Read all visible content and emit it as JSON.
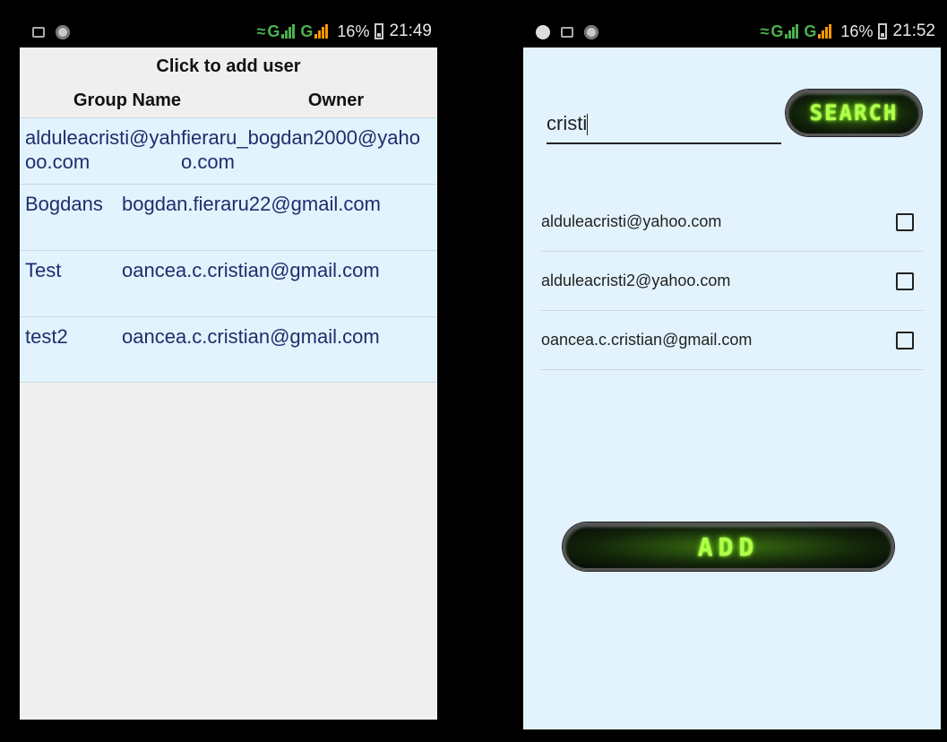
{
  "left": {
    "status": {
      "pct": "16%",
      "time": "21:49"
    },
    "add_user_label": "Click to add user",
    "columns": [
      "Group Name",
      "Owner"
    ],
    "rows": [
      {
        "group": "alduleacristi@yahoo.com",
        "owner": "fieraru_bogdan2000@yahoo.com"
      },
      {
        "group": "Bogdans",
        "owner": "bogdan.fieraru22@gmail.com"
      },
      {
        "group": "Test",
        "owner": "oancea.c.cristian@gmail.com"
      },
      {
        "group": "test2",
        "owner": "oancea.c.cristian@gmail.com"
      }
    ]
  },
  "right": {
    "status": {
      "pct": "16%",
      "time": "21:52"
    },
    "search_value": "cristi",
    "search_label": "SEARCH",
    "results": [
      {
        "email": "alduleacristi@yahoo.com",
        "checked": false
      },
      {
        "email": "alduleacristi2@yahoo.com",
        "checked": false
      },
      {
        "email": "oancea.c.cristian@gmail.com",
        "checked": false
      }
    ],
    "add_label": "ADD"
  },
  "icons": [
    "image-icon",
    "shield-icon",
    "messenger-icon",
    "wifi-icon",
    "signal-icon",
    "battery-icon"
  ]
}
